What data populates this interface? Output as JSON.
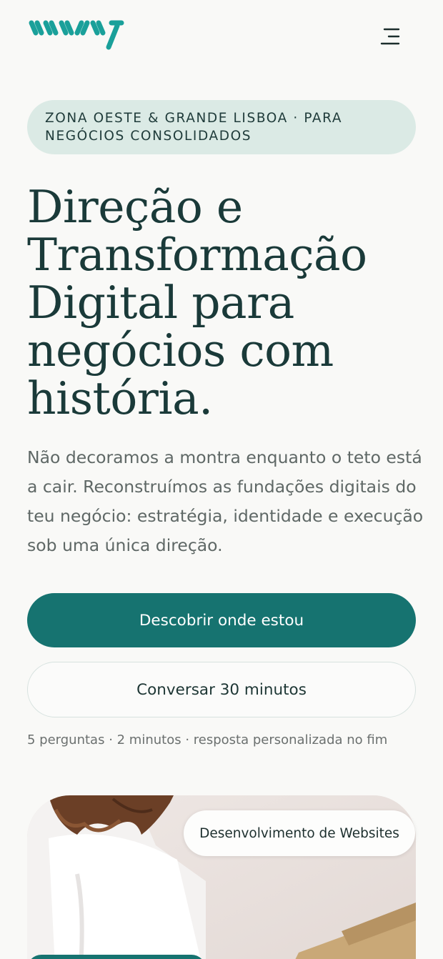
{
  "header": {
    "logo_icon": "wavy-logo-icon",
    "menu_icon": "menu-icon",
    "brand_color": "#1aa09a"
  },
  "hero": {
    "badge": "ZONA OESTE & GRANDE LISBOA · PARA NEGÓCIOS CONSOLIDADOS",
    "title": "Direção e Transformação Digital para negócios com história.",
    "subtitle": "Não decoramos a montra enquanto o teto está a cair. Reconstruímos as fundações digitais do teu negócio: estratégia, identidade e execução sob uma única direção.",
    "primary_cta": "Descobrir onde estou",
    "secondary_cta": "Conversar 30 minutos",
    "hint": "5 perguntas · 2 minutos · resposta personalizada no fim"
  },
  "showcase": {
    "tag": "Desenvolvimento de Websites"
  },
  "colors": {
    "accent": "#167370",
    "badge_bg": "#dbeae5",
    "heading": "#1a3a39",
    "background": "#f9f9f7"
  }
}
